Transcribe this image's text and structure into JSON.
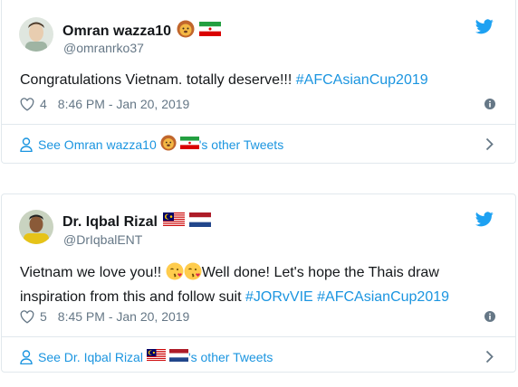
{
  "tweets": [
    {
      "display_name": "Omran wazza10",
      "handle": "@omranrko37",
      "name_emojis": [
        "lion-emoji",
        "iran-flag"
      ],
      "text_plain": "Congratulations Vietnam. totally deserve!!! ",
      "hashtags": [
        "#AFCAsianCup2019"
      ],
      "likes": "4",
      "timestamp": "8:46 PM - Jan 20, 2019",
      "other_tweets_prefix": "See Omran wazza10",
      "other_tweets_suffix": "'s other Tweets",
      "avatar_colors": {
        "skin": "#e8cdb0",
        "bg": "#dfe6df",
        "shirt": "#9fb4a3"
      }
    },
    {
      "display_name": "Dr. Iqbal Rizal",
      "handle": "@DrIqbalENT",
      "name_emojis": [
        "malaysia-flag",
        "netherlands-flag"
      ],
      "text_part1": "Vietnam we love you!! ",
      "text_part2": "Well done! Let's hope the Thais draw inspiration from this and follow suit ",
      "hashtags": [
        "#JORvVIE",
        "#AFCAsianCup2019"
      ],
      "likes": "5",
      "timestamp": "8:45 PM - Jan 20, 2019",
      "other_tweets_prefix": "See Dr. Iqbal Rizal",
      "other_tweets_suffix": "'s other Tweets",
      "avatar_colors": {
        "skin": "#8a5a38",
        "bg": "#c9d3c0",
        "shirt": "#e6c318"
      }
    }
  ],
  "colors": {
    "twitter_blue": "#1da1f2",
    "link_blue": "#1b95e0",
    "meta_gray": "#657786",
    "border": "#e1e8ed",
    "text": "#14171a"
  },
  "icons": [
    "twitter-bird-icon",
    "heart-icon",
    "info-icon",
    "person-icon",
    "chevron-right-icon",
    "kiss-emoji"
  ]
}
